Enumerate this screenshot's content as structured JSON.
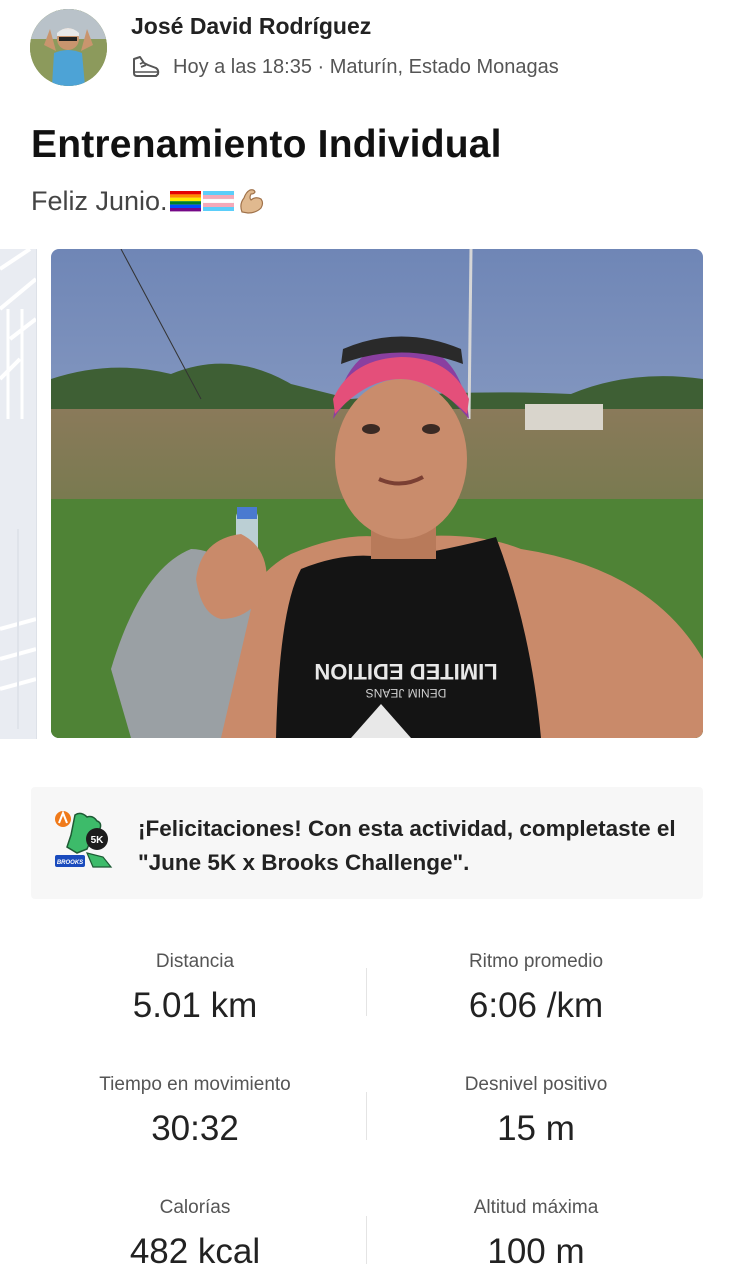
{
  "activity": {
    "user_name": "José David Rodríguez",
    "meta": "Hoy a las 18:35 · Maturín, Estado Monagas",
    "title": "Entrenamiento Individual",
    "description": "Feliz Junio."
  },
  "challenge": {
    "message": "¡Felicitaciones! Con esta actividad, completaste el \"June 5K x Brooks Challenge\".",
    "badge_text": "5K",
    "badge_brand": "BROOKS"
  },
  "photo": {
    "shirt_text_1": "LIMITED EDITION",
    "shirt_text_2": "DENIM JEANS"
  },
  "stats": [
    {
      "label": "Distancia",
      "value": "5.01 km"
    },
    {
      "label": "Ritmo promedio",
      "value": "6:06 /km"
    },
    {
      "label": "Tiempo en movimiento",
      "value": "30:32"
    },
    {
      "label": "Desnivel positivo",
      "value": "15 m"
    },
    {
      "label": "Calorías",
      "value": "482 kcal"
    },
    {
      "label": "Altitud máxima",
      "value": "100 m"
    }
  ],
  "colors": {
    "accent": "#fc4c02",
    "text": "#222222",
    "muted": "#555555",
    "card_bg": "#f7f7f7"
  },
  "icons": {
    "activity_type": "running-shoe-icon",
    "badge": "challenge-badge-icon"
  }
}
